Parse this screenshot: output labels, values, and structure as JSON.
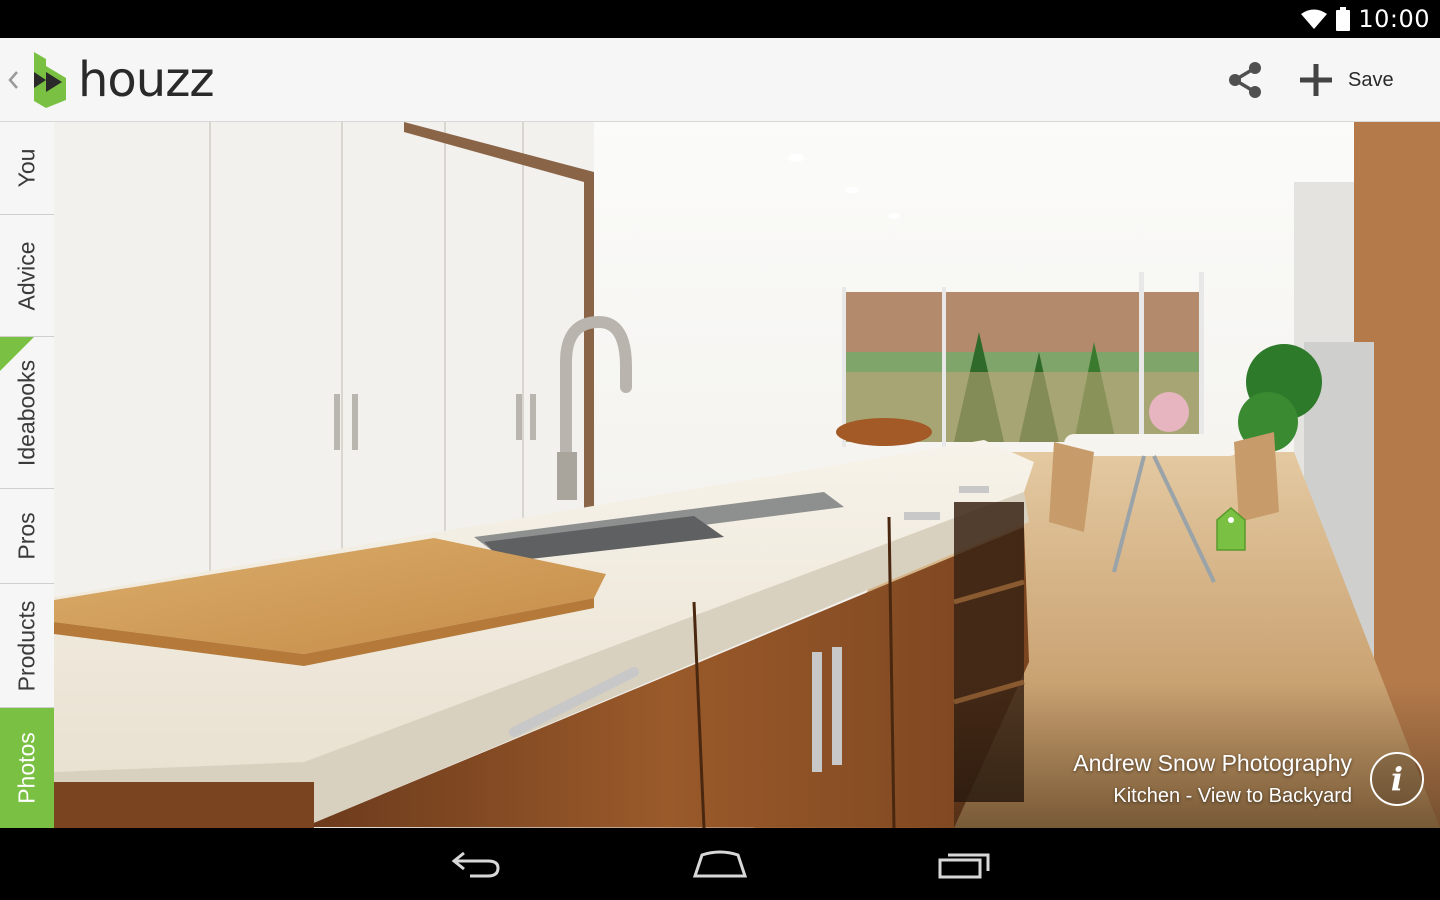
{
  "status_bar": {
    "time": "10:00"
  },
  "app": {
    "logo_text": "houzz",
    "brand_color": "#7ac143"
  },
  "action_bar": {
    "save_label": "Save",
    "share_icon": "share-icon",
    "add_icon": "plus-icon"
  },
  "side_tabs": [
    {
      "label": "You",
      "active": false
    },
    {
      "label": "Advice",
      "active": false
    },
    {
      "label": "Ideabooks",
      "active": false,
      "has_new_marker": true
    },
    {
      "label": "Pros",
      "active": false
    },
    {
      "label": "Products",
      "active": false
    },
    {
      "label": "Photos",
      "active": true
    }
  ],
  "photo": {
    "photographer": "Andrew Snow Photography",
    "title": "Kitchen - View to Backyard",
    "info_icon": "info-icon"
  },
  "nav_bar": {
    "icons": [
      "back-icon",
      "home-icon",
      "recent-apps-icon"
    ]
  }
}
